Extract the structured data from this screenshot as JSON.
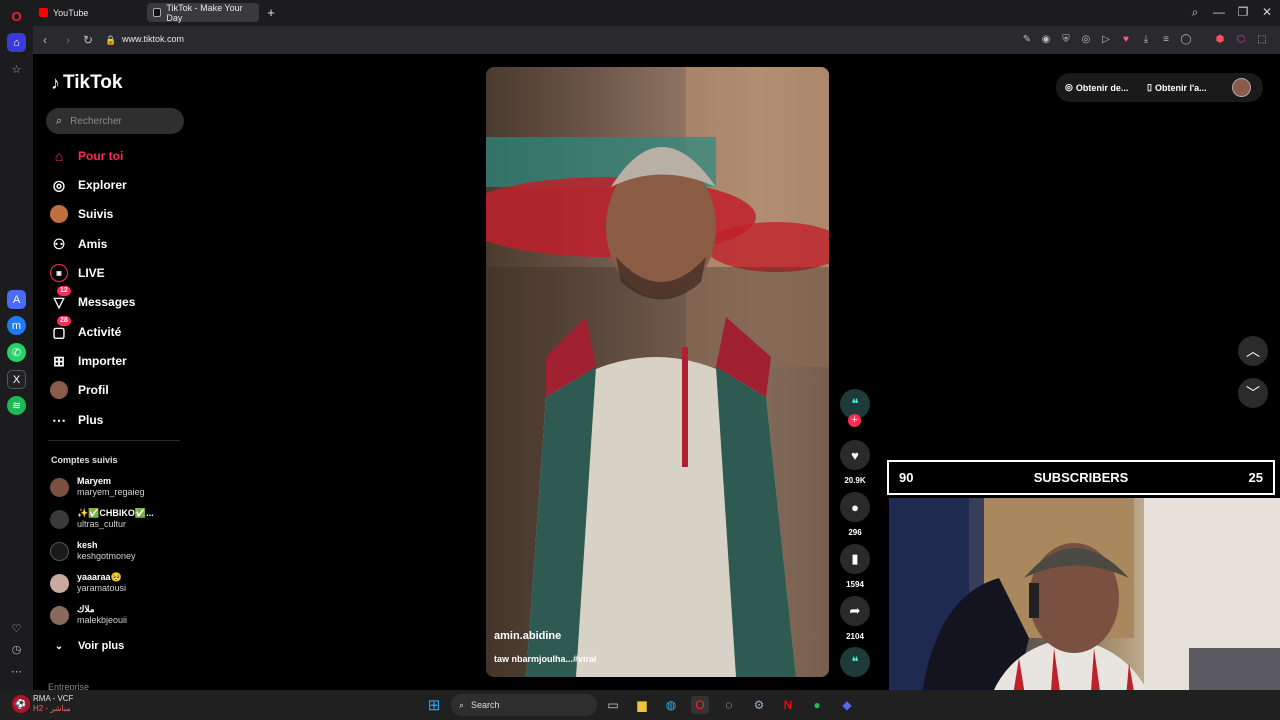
{
  "browser": {
    "tabs": [
      {
        "label": "YouTube"
      },
      {
        "label": "TikTok - Make Your Day"
      }
    ],
    "new_tab_glyph": "+",
    "url": "www.tiktok.com"
  },
  "tiktok": {
    "logo_text": "TikTok",
    "search_placeholder": "Rechercher",
    "nav": [
      {
        "label": "Pour toi",
        "icon": "home-icon"
      },
      {
        "label": "Explorer",
        "icon": "compass-icon"
      },
      {
        "label": "Suivis",
        "icon": "following-avatar-icon"
      },
      {
        "label": "Amis",
        "icon": "friends-icon"
      },
      {
        "label": "LIVE",
        "icon": "live-icon"
      },
      {
        "label": "Messages",
        "icon": "messages-icon",
        "badge": "12"
      },
      {
        "label": "Activité",
        "icon": "activity-icon",
        "badge": "28"
      },
      {
        "label": "Importer",
        "icon": "upload-icon"
      },
      {
        "label": "Profil",
        "icon": "profile-avatar-icon"
      },
      {
        "label": "Plus",
        "icon": "more-icon"
      }
    ],
    "following_header": "Comptes suivis",
    "following": [
      {
        "name": "Maryem",
        "handle": "maryem_regaieg"
      },
      {
        "name": "✨✅CHBIKO✅...",
        "handle": "ultras_cultur"
      },
      {
        "name": "kesh",
        "handle": "keshgotmoney"
      },
      {
        "name": "yaaaraa🥺",
        "handle": "yaramatousi"
      },
      {
        "name": "ملاك",
        "handle": "malekbjeouii"
      }
    ],
    "see_more": "Voir plus",
    "section_cutoff": "Entreprise",
    "top_right": {
      "get_coins": "Obtenir de...",
      "get_app": "Obtenir l'a..."
    },
    "video": {
      "author": "amin.abidine",
      "caption": "taw nbarmjoulha...#viral",
      "likes": "20.9K",
      "comments": "296",
      "saves": "1594",
      "shares": "2104"
    }
  },
  "overlay": {
    "left_count": "90",
    "title": "SUBSCRIBERS",
    "right_count": "25"
  },
  "taskbar": {
    "weather_title": "RMA - VCF",
    "weather_sub": "H2 - مباشر",
    "search_label": "Search"
  },
  "colors": {
    "accent": "#fe2c55",
    "bg": "#000000"
  }
}
